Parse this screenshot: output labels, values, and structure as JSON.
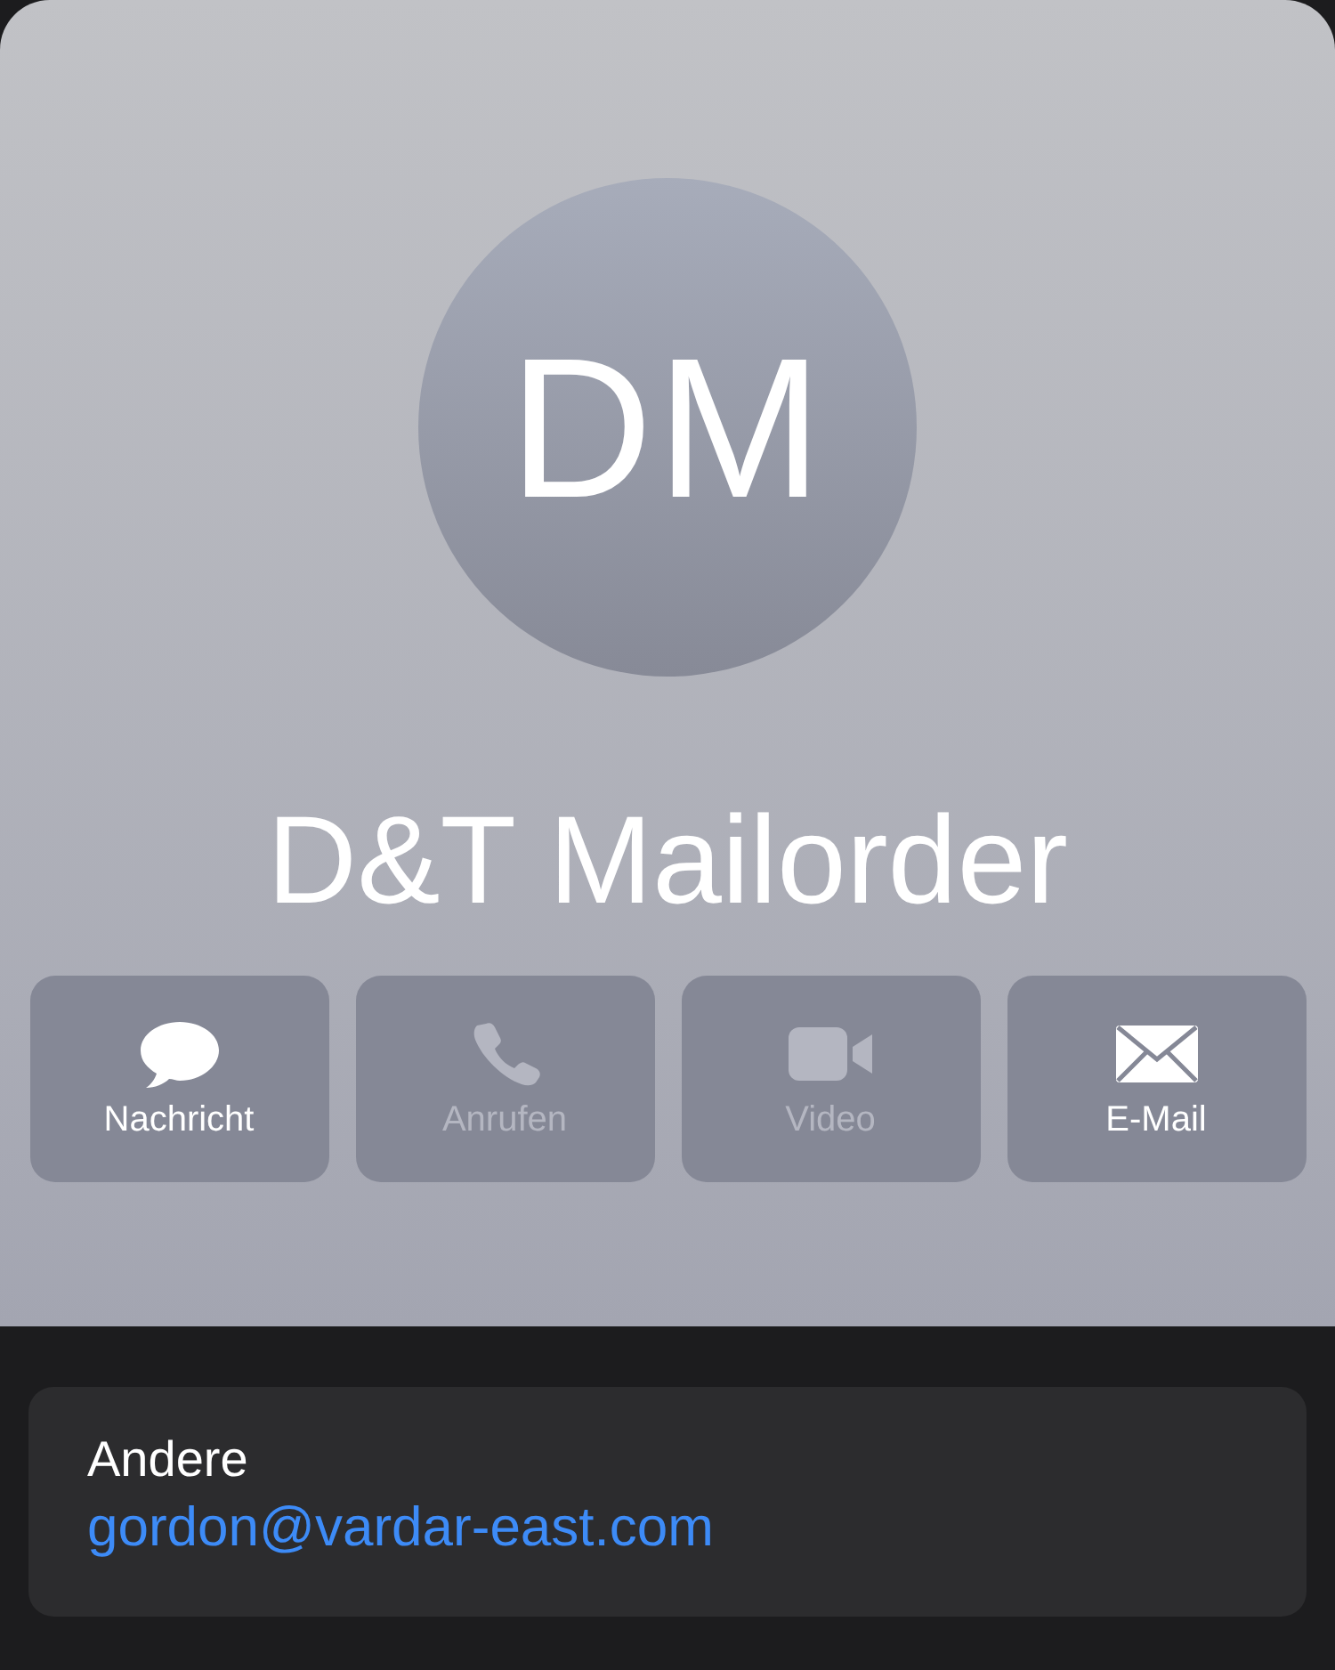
{
  "contact": {
    "initials": "DM",
    "name": "D&T Mailorder"
  },
  "actions": [
    {
      "kind": "message",
      "label": "Nachricht",
      "disabled": false
    },
    {
      "kind": "call",
      "label": "Anrufen",
      "disabled": true
    },
    {
      "kind": "video",
      "label": "Video",
      "disabled": true
    },
    {
      "kind": "mail",
      "label": "E-Mail",
      "disabled": false
    }
  ],
  "info": {
    "label": "Andere",
    "value": "gordon@vardar-east.com"
  }
}
